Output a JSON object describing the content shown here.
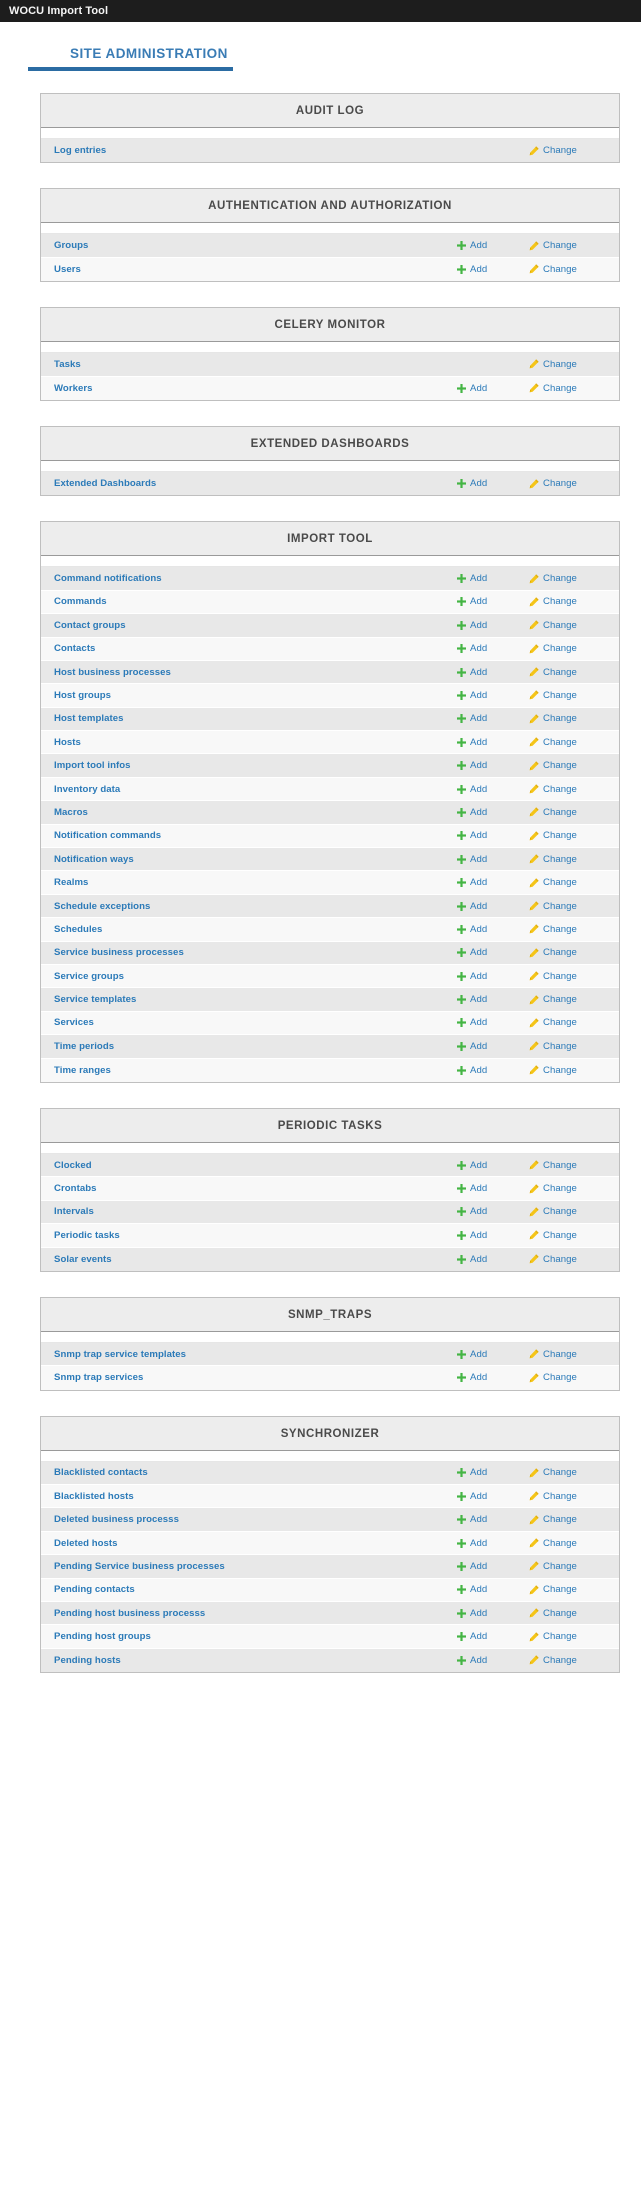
{
  "branding": {
    "site_name": "WOCU Import Tool"
  },
  "page": {
    "title": "SITE ADMINISTRATION"
  },
  "icons": {
    "add": "plus-icon",
    "change": "pencil-icon"
  },
  "colors": {
    "brand_bar": "#1d1d1d",
    "title": "#3a7cb5",
    "title_rule": "#2b6ca3",
    "link": "#2b7ab8",
    "caption_bg": "#ededed",
    "row_odd": "#e8e8e8",
    "row_even": "#f8f8f8",
    "add_icon": "#44b544",
    "change_icon": "#f5c518"
  },
  "labels": {
    "add": "Add",
    "change": "Change"
  },
  "apps": [
    {
      "caption": "AUDIT LOG",
      "models": [
        {
          "name": "Log entries",
          "add": false,
          "change": true
        }
      ]
    },
    {
      "caption": "AUTHENTICATION AND AUTHORIZATION",
      "models": [
        {
          "name": "Groups",
          "add": true,
          "change": true
        },
        {
          "name": "Users",
          "add": true,
          "change": true
        }
      ]
    },
    {
      "caption": "CELERY MONITOR",
      "models": [
        {
          "name": "Tasks",
          "add": false,
          "change": true
        },
        {
          "name": "Workers",
          "add": true,
          "change": true
        }
      ]
    },
    {
      "caption": "EXTENDED DASHBOARDS",
      "models": [
        {
          "name": "Extended Dashboards",
          "add": true,
          "change": true
        }
      ]
    },
    {
      "caption": "IMPORT TOOL",
      "models": [
        {
          "name": "Command notifications",
          "add": true,
          "change": true
        },
        {
          "name": "Commands",
          "add": true,
          "change": true
        },
        {
          "name": "Contact groups",
          "add": true,
          "change": true
        },
        {
          "name": "Contacts",
          "add": true,
          "change": true
        },
        {
          "name": "Host business processes",
          "add": true,
          "change": true
        },
        {
          "name": "Host groups",
          "add": true,
          "change": true
        },
        {
          "name": "Host templates",
          "add": true,
          "change": true
        },
        {
          "name": "Hosts",
          "add": true,
          "change": true
        },
        {
          "name": "Import tool infos",
          "add": true,
          "change": true
        },
        {
          "name": "Inventory data",
          "add": true,
          "change": true
        },
        {
          "name": "Macros",
          "add": true,
          "change": true
        },
        {
          "name": "Notification commands",
          "add": true,
          "change": true
        },
        {
          "name": "Notification ways",
          "add": true,
          "change": true
        },
        {
          "name": "Realms",
          "add": true,
          "change": true
        },
        {
          "name": "Schedule exceptions",
          "add": true,
          "change": true
        },
        {
          "name": "Schedules",
          "add": true,
          "change": true
        },
        {
          "name": "Service business processes",
          "add": true,
          "change": true
        },
        {
          "name": "Service groups",
          "add": true,
          "change": true
        },
        {
          "name": "Service templates",
          "add": true,
          "change": true
        },
        {
          "name": "Services",
          "add": true,
          "change": true
        },
        {
          "name": "Time periods",
          "add": true,
          "change": true
        },
        {
          "name": "Time ranges",
          "add": true,
          "change": true
        }
      ]
    },
    {
      "caption": "PERIODIC TASKS",
      "models": [
        {
          "name": "Clocked",
          "add": true,
          "change": true
        },
        {
          "name": "Crontabs",
          "add": true,
          "change": true
        },
        {
          "name": "Intervals",
          "add": true,
          "change": true
        },
        {
          "name": "Periodic tasks",
          "add": true,
          "change": true
        },
        {
          "name": "Solar events",
          "add": true,
          "change": true
        }
      ]
    },
    {
      "caption": "SNMP_TRAPS",
      "models": [
        {
          "name": "Snmp trap service templates",
          "add": true,
          "change": true
        },
        {
          "name": "Snmp trap services",
          "add": true,
          "change": true
        }
      ]
    },
    {
      "caption": "SYNCHRONIZER",
      "models": [
        {
          "name": "Blacklisted contacts",
          "add": true,
          "change": true
        },
        {
          "name": "Blacklisted hosts",
          "add": true,
          "change": true
        },
        {
          "name": "Deleted business processs",
          "add": true,
          "change": true
        },
        {
          "name": "Deleted hosts",
          "add": true,
          "change": true
        },
        {
          "name": "Pending Service business processes",
          "add": true,
          "change": true
        },
        {
          "name": "Pending contacts",
          "add": true,
          "change": true
        },
        {
          "name": "Pending host business processs",
          "add": true,
          "change": true
        },
        {
          "name": "Pending host groups",
          "add": true,
          "change": true
        },
        {
          "name": "Pending hosts",
          "add": true,
          "change": true
        }
      ]
    }
  ]
}
